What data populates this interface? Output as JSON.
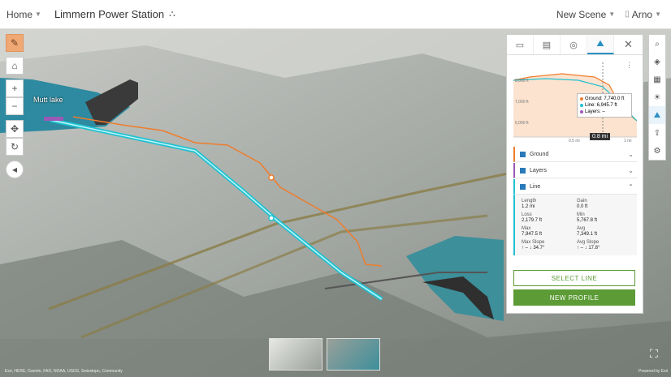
{
  "header": {
    "home_label": "Home",
    "title": "Limmern Power Station",
    "new_scene_label": "New Scene",
    "user_name": "Arno"
  },
  "map": {
    "lake_label": "Mutt lake"
  },
  "left_toolbar": {
    "items": [
      "pencil-icon",
      "home-icon",
      "zoom-in-icon",
      "zoom-out-icon",
      "pan-icon",
      "rotate-icon",
      "compass-icon"
    ]
  },
  "panel": {
    "tabs": [
      "measure-ruler-icon",
      "print-icon",
      "slope-icon",
      "elevation-profile-icon"
    ],
    "tooltip": {
      "ground": "Ground: 7,740.0 ft",
      "line": "Line: 6,945.7 ft",
      "layers": "Layers: –"
    },
    "chart_y_ticks": [
      "8,000 ft",
      "7,000 ft",
      "6,000 ft"
    ],
    "chart_x_ticks": [
      "0.5 mi",
      "1 mi"
    ],
    "distance_badge": "0.8 mi",
    "sections": {
      "ground": "Ground",
      "layers": "Layers",
      "line": "Line"
    },
    "stats": [
      {
        "label": "Length",
        "value": "1.2 mi"
      },
      {
        "label": "Gain",
        "value": "0.0 ft"
      },
      {
        "label": "Loss",
        "value": "2,179.7 ft"
      },
      {
        "label": "Min",
        "value": "5,767.8 ft"
      },
      {
        "label": "Max",
        "value": "7,947.5 ft"
      },
      {
        "label": "Avg",
        "value": "7,349.1 ft"
      },
      {
        "label": "Max Slope",
        "value": "↑ –   ↓ 34.7°"
      },
      {
        "label": "Avg Slope",
        "value": "↑ –   ↓ 17.8°"
      }
    ],
    "select_line_label": "SELECT LINE",
    "new_profile_label": "NEW PROFILE"
  },
  "right_toolbar": {
    "items": [
      "search-icon",
      "layers-icon",
      "basemap-icon",
      "daylight-icon",
      "elevation-profile-icon",
      "share-icon",
      "settings-icon"
    ]
  },
  "footer": {
    "attribution": "Esri, HERE, Garmin, FAO, NOAA, USGS, Swisstopo, Community",
    "powered_by": "Powered by Esri"
  },
  "colors": {
    "accent_blue": "#2a90c4",
    "green": "#5c9b35",
    "line_cyan": "#20c1d0",
    "ground_orange": "#ee7d2d",
    "layers_purple": "#9b59b6"
  }
}
